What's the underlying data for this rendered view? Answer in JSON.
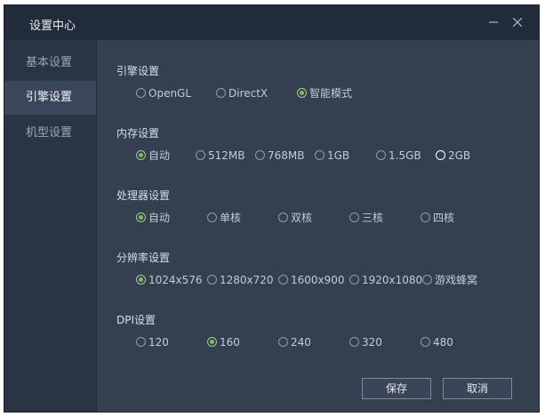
{
  "window": {
    "title": "设置中心",
    "minimize": "—",
    "close": "✕"
  },
  "sidebar": {
    "items": [
      {
        "label": "基本设置",
        "active": false
      },
      {
        "label": "引擎设置",
        "active": true
      },
      {
        "label": "机型设置",
        "active": false
      }
    ]
  },
  "sections": {
    "engine": {
      "title": "引擎设置",
      "options": [
        "OpenGL",
        "DirectX",
        "智能模式"
      ],
      "selected": "智能模式"
    },
    "memory": {
      "title": "内存设置",
      "options": [
        "自动",
        "512MB",
        "768MB",
        "1GB",
        "1.5GB",
        "2GB"
      ],
      "selected": "自动"
    },
    "cpu": {
      "title": "处理器设置",
      "options": [
        "自动",
        "单核",
        "双核",
        "三核",
        "四核"
      ],
      "selected": "自动"
    },
    "resolution": {
      "title": "分辨率设置",
      "options": [
        "1024x576",
        "1280x720",
        "1600x900",
        "1920x1080",
        "游戏蜂窝"
      ],
      "selected": "1024x576"
    },
    "dpi": {
      "title": "DPI设置",
      "options": [
        "120",
        "160",
        "240",
        "320",
        "480"
      ],
      "selected": "160"
    }
  },
  "buttons": {
    "save": "保存",
    "cancel": "取消"
  },
  "colors": {
    "accent": "#7ac34d",
    "background": "#343f50",
    "titlebar": "#222b39",
    "sidebar": "#2a3445"
  }
}
